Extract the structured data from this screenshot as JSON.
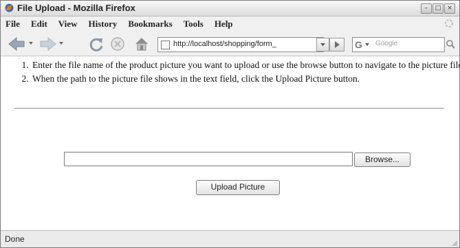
{
  "window": {
    "title": "File Upload - Mozilla Firefox"
  },
  "menu": {
    "items": [
      "File",
      "Edit",
      "View",
      "History",
      "Bookmarks",
      "Tools",
      "Help"
    ]
  },
  "nav": {
    "url": "http://localhost/shopping/form_",
    "search_placeholder": "Google",
    "search_engine_letter": "G"
  },
  "content": {
    "instructions": [
      "Enter the file name of the product picture you want to upload or use the browse button to navigate to the picture file.",
      "When the path to the picture file shows in the text field, click the Upload Picture button."
    ],
    "file_input_value": "",
    "browse_label": "Browse...",
    "upload_label": "Upload Picture"
  },
  "status": {
    "text": "Done"
  },
  "colors": {
    "chrome": "#f0f0f0",
    "content_bg": "#ffffff",
    "border": "#7a7a7a"
  }
}
